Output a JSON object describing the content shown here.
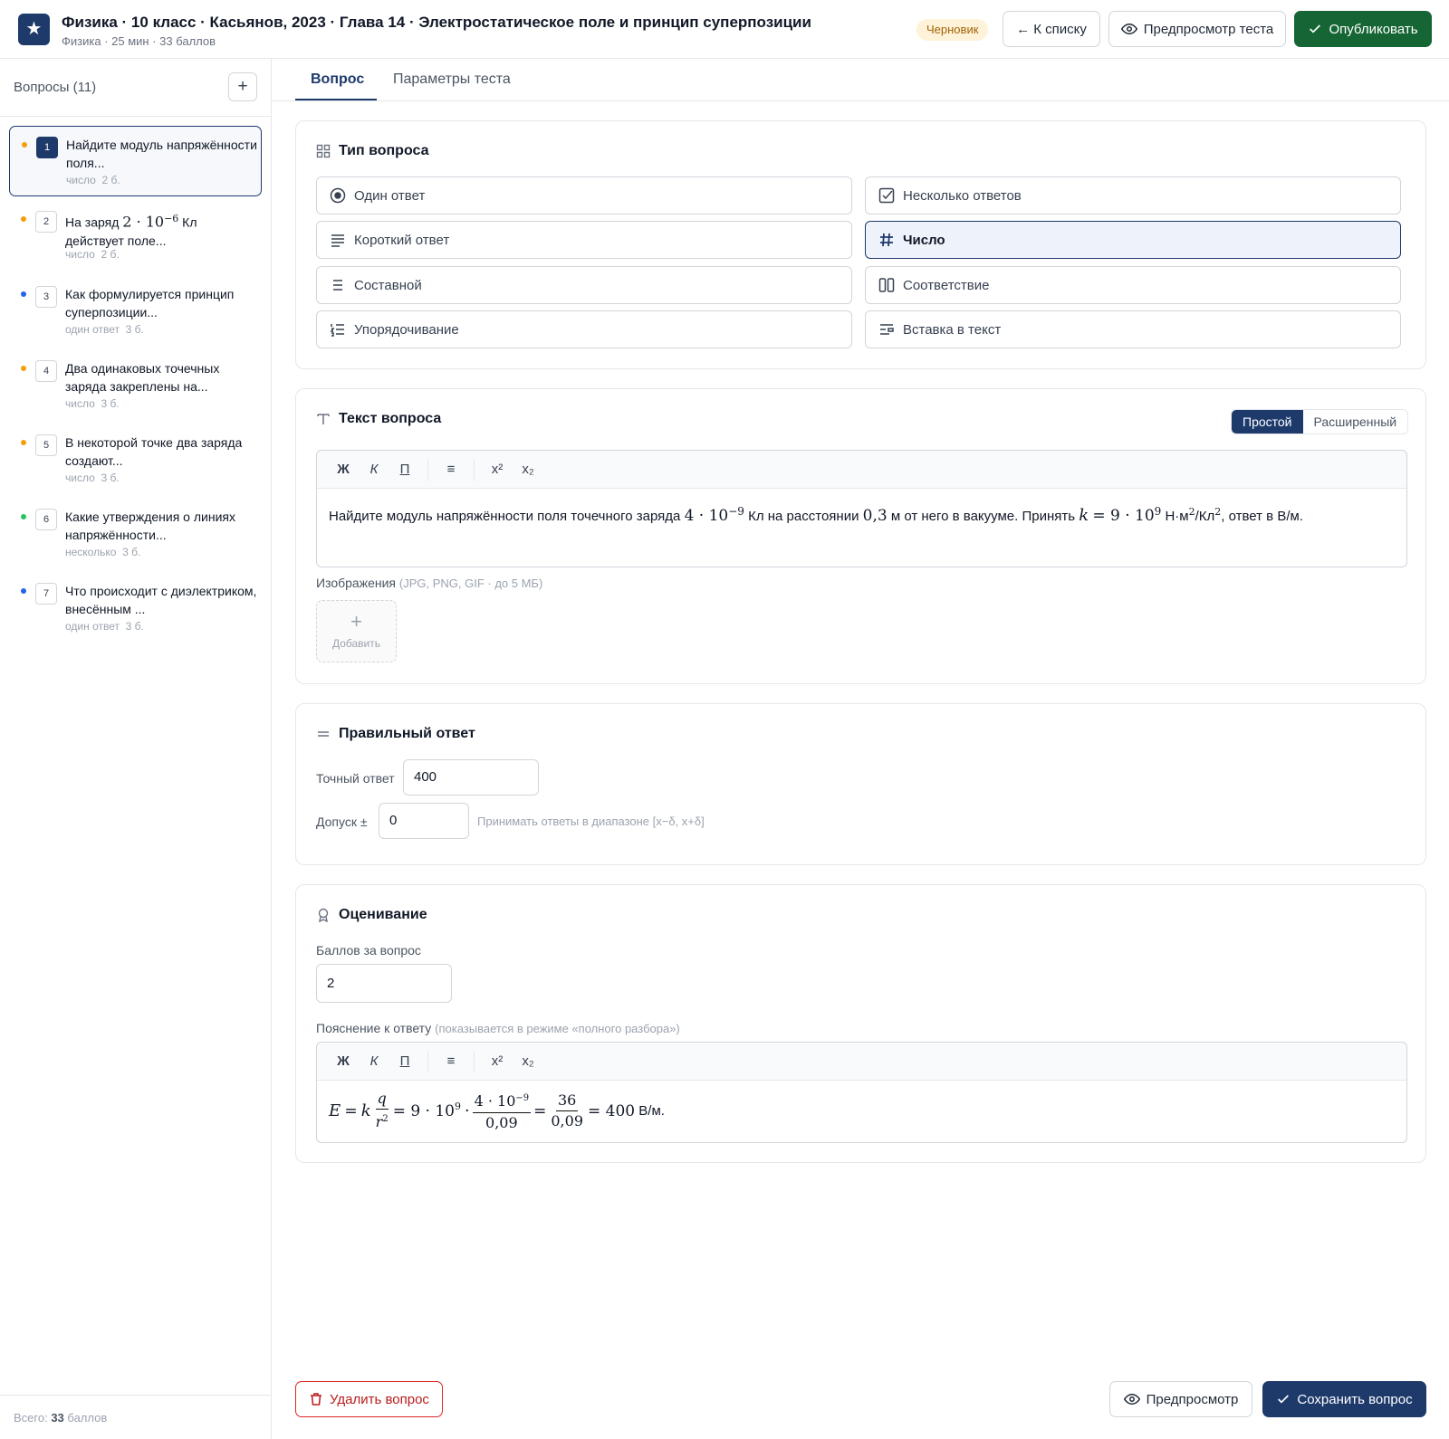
{
  "header": {
    "logo_glyph": "★",
    "title": "Физика · 10 класс · Касьянов, 2023 · Глава 14 · Электростатическое поле и принцип суперпозиции",
    "subtitle": "Физика · 25 мин · 33 баллов",
    "status": "Черновик",
    "back_label": "← К списку",
    "preview_test_label": "Предпросмотр теста",
    "publish_label": "Опубликовать"
  },
  "sidebar": {
    "title": "Вопросы (11)",
    "add_glyph": "+",
    "total_prefix": "Всего:",
    "total_value": "33",
    "total_suffix": "баллов",
    "items": [
      {
        "num": "1",
        "text": "Найдите модуль напряжённости поля...",
        "type": "число",
        "points": "2 б.",
        "dot": "#f59e0b"
      },
      {
        "num": "2",
        "text_pre": "На заряд",
        "text_math": "2 · 10",
        "text_sup": "−6",
        "text_post": "Кл действует поле...",
        "type": "число",
        "points": "2 б.",
        "dot": "#f59e0b"
      },
      {
        "num": "3",
        "text": "Как формулируется принцип суперпозиции...",
        "type": "один ответ",
        "points": "3 б.",
        "dot": "#2563eb"
      },
      {
        "num": "4",
        "text": "Два одинаковых точечных заряда закреплены на...",
        "type": "число",
        "points": "3 б.",
        "dot": "#f59e0b"
      },
      {
        "num": "5",
        "text": "В некоторой точке два заряда создают...",
        "type": "число",
        "points": "3 б.",
        "dot": "#f59e0b"
      },
      {
        "num": "6",
        "text": "Какие утверждения о линиях напряжённости...",
        "type": "несколько",
        "points": "3 б.",
        "dot": "#22c55e"
      },
      {
        "num": "7",
        "text": "Что происходит с диэлектриком, внесённым ...",
        "type": "один ответ",
        "points": "3 б.",
        "dot": "#2563eb"
      }
    ]
  },
  "tabs": {
    "question": "Вопрос",
    "params": "Параметры теста"
  },
  "question_type": {
    "title": "Тип вопроса",
    "options": [
      {
        "label": "Один ответ",
        "icon": "radio-icon"
      },
      {
        "label": "Несколько ответов",
        "icon": "checkbox-icon"
      },
      {
        "label": "Короткий ответ",
        "icon": "lines-icon"
      },
      {
        "label": "Число",
        "icon": "hash-icon"
      },
      {
        "label": "Составной",
        "icon": "list-icon"
      },
      {
        "label": "Соответствие",
        "icon": "columns-icon"
      },
      {
        "label": "Упорядочивание",
        "icon": "ordered-list-icon"
      },
      {
        "label": "Вставка в текст",
        "icon": "insert-text-icon"
      }
    ],
    "selected": "Число"
  },
  "question_text": {
    "title": "Текст вопроса",
    "mode_simple": "Простой",
    "mode_advanced": "Расширенный",
    "toolbar": {
      "bold": "Ж",
      "italic": "К",
      "underline": "П",
      "align": "≡",
      "sup": "x²",
      "sub": "x₂"
    },
    "t1": "Найдите модуль напряжённости поля точечного заряда",
    "m1": "4 · 10",
    "m1_sup": "−9",
    "t2": "Кл на расстоянии",
    "m2": "0,3",
    "t3": "м от него в вакууме. Принять",
    "m3_var": "k",
    "m3": "= 9 · 10",
    "m3_sup": "9",
    "t4": "Н·м",
    "t4_sup": "2",
    "t5": "/Кл",
    "t5_sup": "2",
    "t6": ", ответ в В/м.",
    "images_label": "Изображения",
    "images_hint": "(JPG, PNG, GIF · до 5 МБ)",
    "add_image_glyph": "+",
    "add_image": "Добавить"
  },
  "correct_answer": {
    "title": "Правильный ответ",
    "exact_label": "Точный ответ",
    "exact_value": "400",
    "tolerance_label": "Допуск ±",
    "tolerance_value": "0",
    "tolerance_hint": "Принимать ответы в диапазоне [x−δ, x+δ]"
  },
  "grading": {
    "title": "Оценивание",
    "points_label": "Баллов за вопрос",
    "points_value": "2",
    "explanation_label": "Пояснение к ответу",
    "explanation_hint": "(показывается в режиме «полного разбора»)",
    "formula": {
      "e": "E",
      "eq": "=",
      "k": "k",
      "q": "q",
      "r": "r",
      "r_sup": "2",
      "eq2": "= 9 · 10",
      "sup9": "9",
      "dot": "·",
      "num2": "4 · 10",
      "num2_sup": "−9",
      "den2": "0,09",
      "eq3": "=",
      "num3": "36",
      "den3": "0,09",
      "result": "= 400",
      "unit": "В/м."
    }
  },
  "footer": {
    "delete_label": "Удалить вопрос",
    "preview_label": "Предпросмотр",
    "save_label": "Сохранить вопрос"
  },
  "colors": {
    "accent": "#1e3a6b",
    "publish": "#166534",
    "danger": "#dc2626"
  }
}
